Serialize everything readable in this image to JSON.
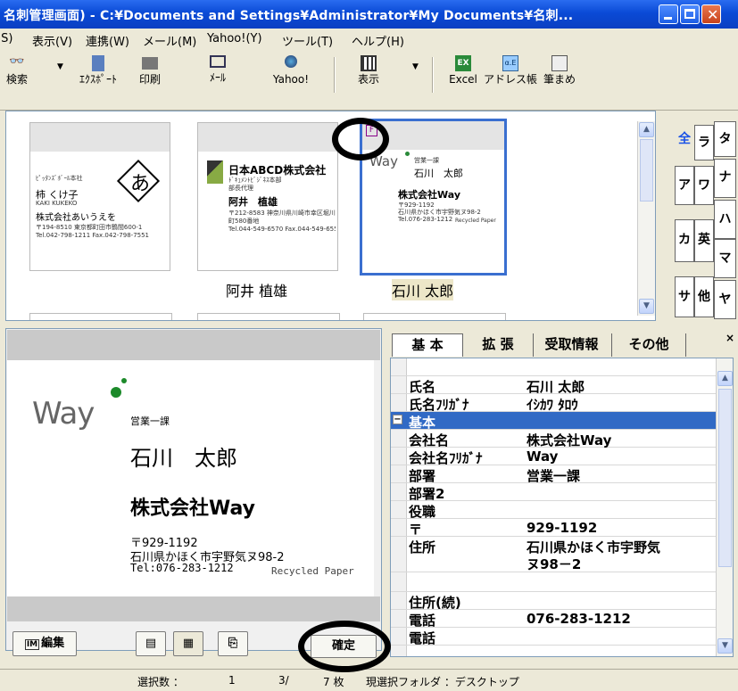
{
  "window": {
    "title": "名刺管理画面) - C:¥Documents and Settings¥Administrator¥My Documents¥名刺..."
  },
  "menu": [
    "(S)",
    "表示(V)",
    "連携(W)",
    "メール(M)",
    "Yahoo!(Y)",
    "ツール(T)",
    "ヘルプ(H)"
  ],
  "toolbar": {
    "search": "検索",
    "export": "ｴｸｽﾎﾟｰﾄ",
    "print": "印刷",
    "mail": "ﾒｰﾙ",
    "yahoo": "Yahoo!",
    "view": "表示",
    "excel": "Excel",
    "addressbook": "アドレス帳",
    "fudemame": "筆まめ"
  },
  "gallery": {
    "cards": [
      {
        "name": "",
        "small1": "ﾋﾟｯﾀﾝｽﾞﾎﾞｰﾙ本社",
        "person": "柿 くけ子",
        "small2": "KAKI KUKEKO",
        "company": "株式会社あいうえを",
        "addr": "〒194-8510 東京都町田市鶴間600-1",
        "tel": "Tel.042-798-1211 Fax.042-798-7551",
        "logo": "あ"
      },
      {
        "name": "阿井 植雄",
        "company": "日本ABCD株式会社",
        "dept": "ﾄﾞｷｭﾒﾝﾄﾋﾞｼﾞﾈｽ本部",
        "role": "部長代理",
        "person": "阿井　植雄",
        "addr": "〒212-8583 神奈川県川崎市幸区堀川町580番地",
        "tel": "Tel.044-549-6570 Fax.044-549-6556"
      },
      {
        "name": "石川 太郎",
        "badge": "F",
        "dept": "営業一課",
        "person": "石川　太郎",
        "company": "株式会社Way",
        "addr1": "〒929-1192",
        "addr2": "石川県かほく市宇野気ヌ98-2",
        "tel": "Tel.076-283-1212",
        "recycled": "Recycled Paper",
        "logo": "Way"
      }
    ]
  },
  "kana": {
    "all": "全",
    "ra": "ラ",
    "ta": "タ",
    "na": "ナ",
    "a": "ア",
    "wa": "ワ",
    "ha": "ハ",
    "ka": "カ",
    "ei": "英",
    "ma": "マ",
    "sa": "サ",
    "other": "他",
    "ya": "ヤ"
  },
  "card": {
    "logo": "Way",
    "dept": "営業一課",
    "name": "石川　太郎",
    "company": "株式会社Way",
    "zip": "〒929-1192",
    "addr": "石川県かほく市宇野気ヌ98-2",
    "tel": "Tel:076-283-1212",
    "recycled": "Recycled Paper"
  },
  "buttons": {
    "edit": "編集",
    "confirm": "確定"
  },
  "tabs": {
    "basic": "基 本",
    "ext": "拡 張",
    "received": "受取情報",
    "other": "その他"
  },
  "props": [
    {
      "k": "氏名",
      "v": "石川 太郎"
    },
    {
      "k": "氏名ﾌﾘｶﾞﾅ",
      "v": "ｲｼｶﾜ ﾀﾛｳ"
    },
    {
      "k": "基本",
      "v": "",
      "group": "⊟"
    },
    {
      "k": "会社名",
      "v": "株式会社Way"
    },
    {
      "k": "会社名ﾌﾘｶﾞﾅ",
      "v": "Way"
    },
    {
      "k": "部署",
      "v": "営業一課"
    },
    {
      "k": "部署2",
      "v": ""
    },
    {
      "k": "役職",
      "v": ""
    },
    {
      "k": "〒",
      "v": "929-1192"
    },
    {
      "k": "住所",
      "v": "石川県かほく市宇野気",
      "v2": "ヌ98－2"
    },
    {
      "k": "住所(続)",
      "v": ""
    },
    {
      "k": "電話",
      "v": "076-283-1212"
    },
    {
      "k": "電話",
      "v": ""
    }
  ],
  "status": {
    "label": "選択数 ：",
    "count": "1",
    "page": "3/",
    "total": "7 枚",
    "folder": "現選択フォルダ ：デスクトップ"
  }
}
